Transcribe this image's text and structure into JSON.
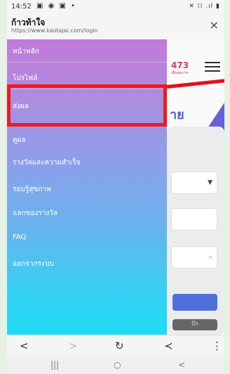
{
  "status_bar": {
    "time": "14:52",
    "left_icons": "▣ ◉ ▣ •",
    "right_icons": "✕ ⁞⁞ .ıl ▮"
  },
  "browser": {
    "page_title": "ก้าวท้าใจ",
    "url": "https://www.kaotajai.com/login",
    "close_glyph": "×"
  },
  "drawer": {
    "items": [
      {
        "label": "หน้าหลัก"
      },
      {
        "label": "โปรไฟล์"
      },
      {
        "label": "ส่งผล",
        "highlighted": true
      },
      {
        "label": "ดูผล"
      },
      {
        "label": "รางวัลและความสำเร็จ"
      },
      {
        "label": "รอบรู้สุขภาพ"
      },
      {
        "label": "แลกของรางวัล"
      },
      {
        "label": "FAQ"
      },
      {
        "label": "ออกจากระบบ"
      }
    ],
    "highlight_color": "#ef1b1b"
  },
  "background_page": {
    "logo_number": "473",
    "logo_sub": "เพื่อสุขภาพ",
    "heading_fragment": "าย",
    "field_placeholder": "ก",
    "button2_fragment": "บึก"
  },
  "toolbar": {
    "back": "<",
    "forward": ">",
    "reload": "↻",
    "share": "≺",
    "more": "⋮"
  },
  "nav": {
    "recents": "|||",
    "home": "○",
    "back": "<"
  }
}
